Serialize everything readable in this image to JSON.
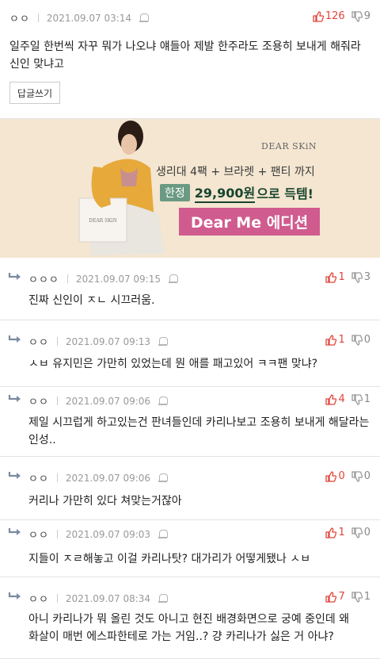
{
  "main": {
    "nick": "ㅇㅇ",
    "date": "2021.09.07 03:14",
    "up": "126",
    "down": "9",
    "text": "일주일 한번씩 자꾸 뭐가 나오냐 얘들아 제발 한주라도 조용히 보내게 해줘라 신인 맞냐고",
    "reply_button": "답글쓰기"
  },
  "ad": {
    "brand": "DEAR SKiN",
    "line1": "생리대 4팩 + 브라렛 + 팬티 까지",
    "badge": "한정",
    "price": "29,900원",
    "deal_suffix": "으로 득템!",
    "event": "Dear Me 에디션",
    "box_label": "DEAR SKiN"
  },
  "replies": [
    {
      "nick": "ㅇㅇㅇ",
      "date": "2021.09.07 09:15",
      "up": "1",
      "down": "3",
      "text": "진짜 신인이 ㅈㄴ 시끄러움."
    },
    {
      "nick": "ㅇㅇ",
      "date": "2021.09.07 09:13",
      "up": "1",
      "down": "0",
      "text": "ㅅㅂ 유지민은 가만히 있었는데 뭔 애를 패고있어 ㅋㅋ팬 맞냐?"
    },
    {
      "nick": "ㅇㅇ",
      "date": "2021.09.07 09:06",
      "up": "4",
      "down": "1",
      "text": "제일 시끄럽게 하고있는건 판녀들인데 카리나보고 조용히 보내게 해달라는 인성.."
    },
    {
      "nick": "ㅇㅇ",
      "date": "2021.09.07 09:06",
      "up": "0",
      "down": "0",
      "text": "커리나 가만히 있다 쳐맞는거잖아"
    },
    {
      "nick": "ㅇㅇ",
      "date": "2021.09.07 09:03",
      "up": "1",
      "down": "0",
      "text": "지들이 ㅈㄹ해놓고 이걸 카리나탓? 대가리가 어떻게됐나 ㅅㅂ"
    },
    {
      "nick": "ㅇㅇ",
      "date": "2021.09.07 08:34",
      "up": "7",
      "down": "1",
      "text": "아니 카리나가 뭐 올린 것도 아니고 현진 배경화면으로 궁예 중인데 왜 화살이 매번 에스파한테로 가는 거임..? 걍 카리나가 싫은 거 아냐?"
    }
  ]
}
